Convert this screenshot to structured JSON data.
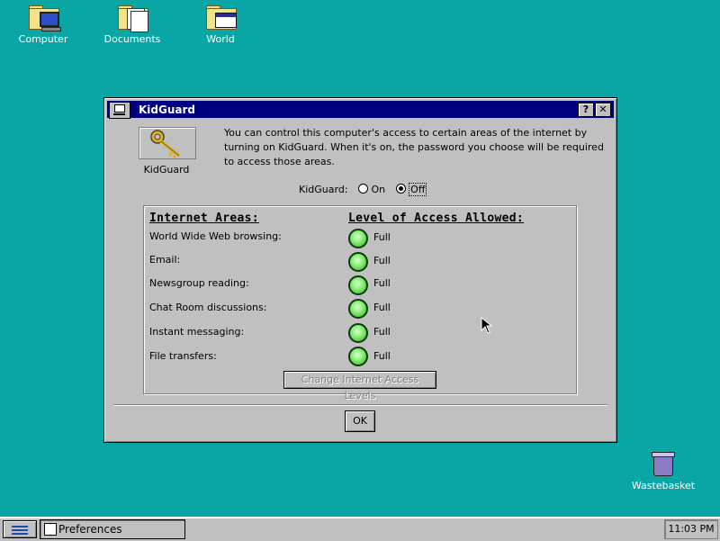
{
  "desktop": {
    "icons": [
      {
        "label": "Computer",
        "icon": "computer-folder-icon"
      },
      {
        "label": "Documents",
        "icon": "documents-folder-icon"
      },
      {
        "label": "World",
        "icon": "world-folder-icon"
      }
    ],
    "wastebasket": {
      "label": "Wastebasket",
      "icon": "wastebasket-icon"
    }
  },
  "window": {
    "title": "KidGuard",
    "help_button": "?",
    "close_button": "✕",
    "app_label": "KidGuard",
    "description": "You can control this computer's access to certain areas of the internet by turning on KidGuard.  When it's on, the password you choose will be required to access those areas.",
    "kidguard_toggle": {
      "label": "KidGuard:",
      "on_label": "On",
      "off_label": "Off",
      "selected": "Off"
    },
    "areas_header": "Internet Areas:",
    "access_header": "Level of Access Allowed:",
    "areas": [
      {
        "name": "World Wide Web browsing:",
        "access": "Full"
      },
      {
        "name": "Email:",
        "access": "Full"
      },
      {
        "name": "Newsgroup reading:",
        "access": "Full"
      },
      {
        "name": "Chat Room discussions:",
        "access": "Full"
      },
      {
        "name": "Instant messaging:",
        "access": "Full"
      },
      {
        "name": "File transfers:",
        "access": "Full"
      }
    ],
    "change_button": "Change Internet Access Levels",
    "ok_button": "OK"
  },
  "taskbar": {
    "task_label": "Preferences",
    "clock": "11:03 PM"
  },
  "colors": {
    "desktop": "#0aa5a5",
    "titlebar": "#000080",
    "access_full": "#8df07a"
  }
}
